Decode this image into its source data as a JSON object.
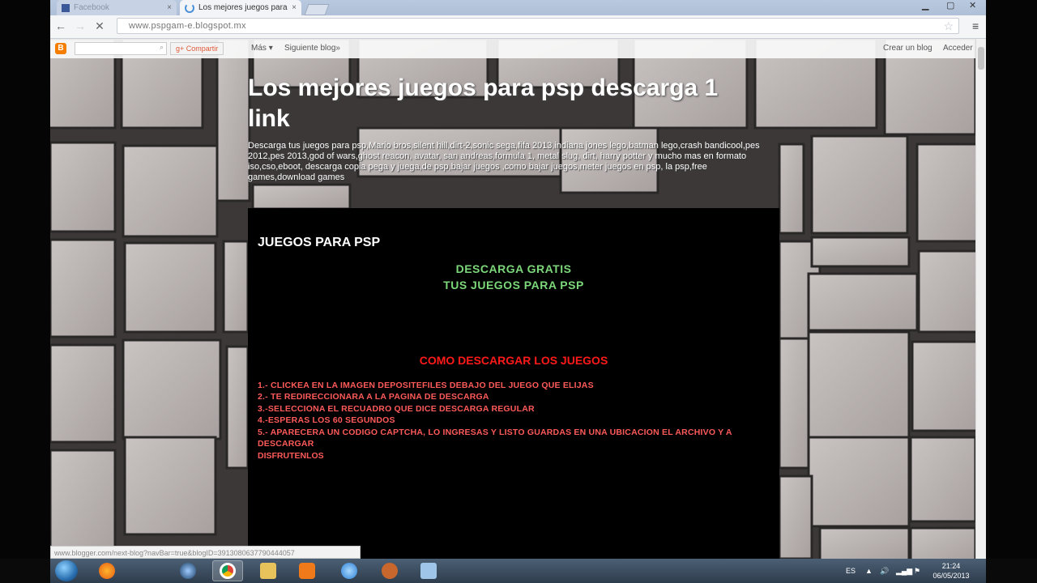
{
  "browser": {
    "tabs": [
      {
        "label": "Facebook",
        "active": false
      },
      {
        "label": "Los mejores juegos para p",
        "active": true
      }
    ],
    "url": "www.pspgam-e.blogspot.mx",
    "close_glyph": "×"
  },
  "navbar": {
    "share_label": "Compartir",
    "more_label": "Más",
    "next_blog_label": "Siguiente blog»",
    "create_blog_label": "Crear un blog",
    "sign_in_label": "Acceder"
  },
  "header": {
    "title": "Los mejores juegos para psp descarga 1 link",
    "description": "Descarga tus juegos para psp,Mario bros,silent hill,dirt-2,sonic sega,fifa 2013,indiana jones lego,batman lego,crash bandicool,pes 2012,pes 2013,god of wars,ghost reacon, avatar, san andreas,formula 1, metal slug, dirt, harry potter y mucho mas en formato iso,cso,eboot, descarga copia pega y juega,de psp,bajar juegos ,como bajar juegos,meter juegos en psp, la psp,free games,download games"
  },
  "post": {
    "title": "JUEGOS PARA PSP",
    "promo_line1": "DESCARGA GRATIS",
    "promo_line2": "TUS JUEGOS PARA PSP",
    "howto_heading": "COMO DESCARGAR LOS JUEGOS",
    "steps": [
      "1.- CLICKEA EN LA IMAGEN DEPOSITEFILES  DEBAJO DEL JUEGO QUE ELIJAS",
      "2.- TE REDIRECCIONARA A LA PAGINA DE DESCARGA",
      "3.-SELECCIONA EL RECUADRO QUE DICE DESCARGA REGULAR",
      "4.-ESPERAS LOS 60 SEGUNDOS",
      "5.- APARECERA UN CODIGO CAPTCHA, LO INGRESAS Y LISTO GUARDAS EN UNA UBICACION EL ARCHIVO Y A DESCARGAR"
    ],
    "closing": "DISFRUTENLOS"
  },
  "status_bar": {
    "url": "www.blogger.com/next-blog?navBar=true&blogID=3913080637790444057"
  },
  "taskbar": {
    "language": "ES",
    "time": "21:24",
    "date": "06/05/2013",
    "apps": [
      "firefox-icon",
      "steam-icon",
      "chrome-icon",
      "folder-icon",
      "media-player-icon",
      "itunes-icon",
      "baseball-icon",
      "app-window-icon"
    ]
  },
  "colors": {
    "promo_green": "#7cd87a",
    "howto_red": "#ff1a1a",
    "steps_red": "#ff5a5a"
  }
}
